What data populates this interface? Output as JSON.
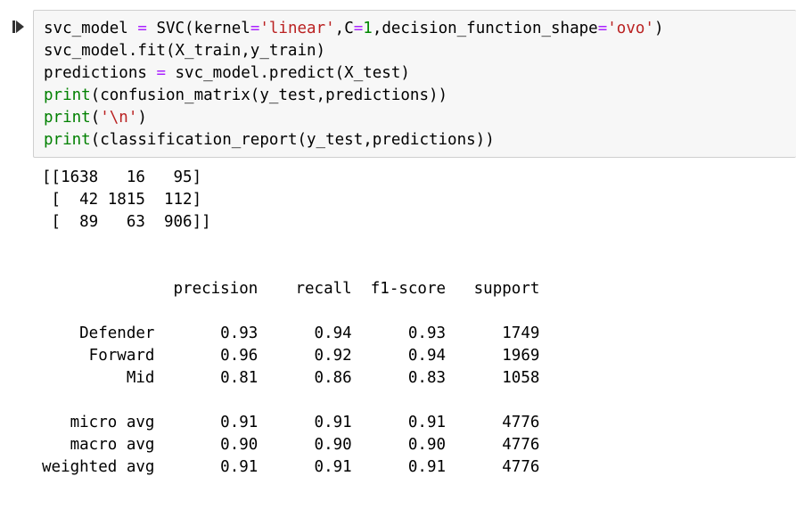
{
  "cell": {
    "run_icon": "run-cell-icon",
    "code_lines": [
      [
        "svc_model ",
        "=",
        " SVC(kernel",
        "=",
        "'linear'",
        ",C",
        "=",
        "1",
        ",decision_function_shape",
        "=",
        "'ovo'",
        ")"
      ],
      [
        "svc_model.fit(X_train,y_train)"
      ],
      [
        "predictions ",
        "=",
        " svc_model.predict(X_test)"
      ],
      [
        "print",
        "(confusion_matrix(y_test,predictions))"
      ],
      [
        "print",
        "(",
        "'\\n'",
        ")"
      ],
      [
        "print",
        "(classification_report(y_test,predictions))"
      ]
    ],
    "output_lines": [
      "[[1638   16   95]",
      " [  42 1815  112]",
      " [  89   63  906]]",
      "",
      "",
      "              precision    recall  f1-score   support",
      "",
      "    Defender       0.93      0.94      0.93      1749",
      "     Forward       0.96      0.92      0.94      1969",
      "         Mid       0.81      0.86      0.83      1058",
      "",
      "   micro avg       0.91      0.91      0.91      4776",
      "   macro avg       0.90      0.90      0.90      4776",
      "weighted avg       0.91      0.91      0.91      4776"
    ]
  },
  "colors": {
    "operator": "#aa22ff",
    "string": "#ba2121",
    "number": "#008800",
    "builtin": "#008000",
    "input_background": "#f7f7f7",
    "input_border": "#cfcfcf"
  }
}
